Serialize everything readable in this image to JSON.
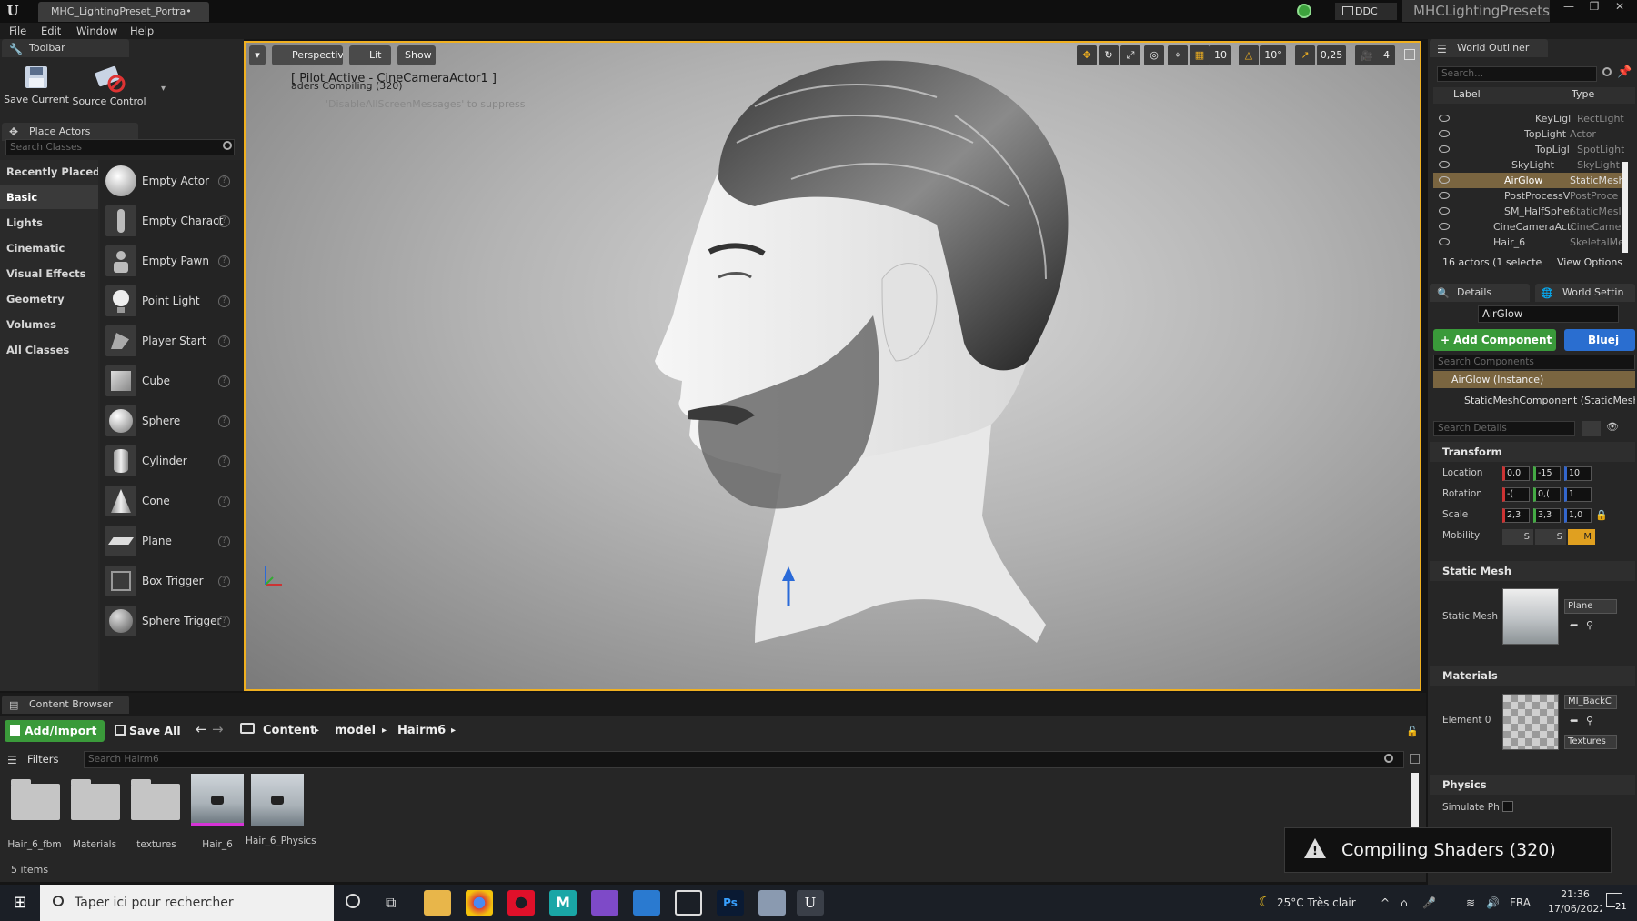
{
  "window": {
    "tab_title": "MHC_LightingPreset_Portra•",
    "ddc_label": "DDC",
    "project_name": "MHCLightingPresets"
  },
  "menu": [
    "File",
    "Edit",
    "Window",
    "Help"
  ],
  "toolbar": {
    "tab_label": "Toolbar",
    "save_current": "Save Current",
    "source_control": "Source Control"
  },
  "place_actors": {
    "tab_label": "Place Actors",
    "search_placeholder": "Search Classes",
    "categories": [
      "Recently Placed",
      "Basic",
      "Lights",
      "Cinematic",
      "Visual Effects",
      "Geometry",
      "Volumes",
      "All Classes"
    ],
    "active_category": "Basic",
    "items": [
      "Empty Actor",
      "Empty Charact",
      "Empty Pawn",
      "Point Light",
      "Player Start",
      "Cube",
      "Sphere",
      "Cylinder",
      "Cone",
      "Plane",
      "Box Trigger",
      "Sphere Trigger"
    ]
  },
  "viewport": {
    "perspective": "Perspective",
    "lit": "Lit",
    "show": "Show",
    "pilot_message": "[ Pilot Active - CineCameraActor1 ]",
    "compiling_message": "aders Compiling (320)",
    "suppress_message": "'DisableAllScreenMessages' to suppress",
    "grid_snap": "10",
    "rotation_snap": "10°",
    "scale_snap": "0,25",
    "camera_speed": "4"
  },
  "world_outliner": {
    "tab_label": "World Outliner",
    "search_placeholder": "Search...",
    "col_label": "Label",
    "col_type": "Type",
    "rows": [
      {
        "label": "KeyLigl",
        "type": "RectLight",
        "selected": false
      },
      {
        "label": "TopLight",
        "type": "Actor",
        "selected": false
      },
      {
        "label": "TopLigl",
        "type": "SpotLight",
        "selected": false
      },
      {
        "label": "SkyLight",
        "type": "SkyLight",
        "selected": false
      },
      {
        "label": "AirGlow",
        "type": "StaticMesh",
        "selected": true
      },
      {
        "label": "PostProcessV",
        "type": "PostProce",
        "selected": false
      },
      {
        "label": "SM_HalfSpher",
        "type": "StaticMesl",
        "selected": false
      },
      {
        "label": "CineCameraActc",
        "type": "CineCame",
        "selected": false
      },
      {
        "label": "Hair_6",
        "type": "SkeletalMe",
        "selected": false
      }
    ],
    "actor_count": "16 actors (1 selecte",
    "view_options": "View Options"
  },
  "details": {
    "tab_label": "Details",
    "world_settings_tab": "World Settin",
    "object_name": "AirGlow",
    "add_component": "+ Add Component",
    "blueprint": "Bluej",
    "search_components": "Search Components",
    "instance": "AirGlow (Instance)",
    "component": "StaticMeshComponent (StaticMeshC",
    "search_details": "Search Details",
    "transform_header": "Transform",
    "location_label": "Location",
    "rotation_label": "Rotation",
    "scale_label": "Scale",
    "mobility_label": "Mobility",
    "location": [
      "0,0",
      "-15",
      "10"
    ],
    "rotation": [
      "-(",
      "0,(",
      "1"
    ],
    "scale": [
      "2,3",
      "3,3",
      "1,0"
    ],
    "mobility_options": [
      "S",
      "S",
      "M"
    ],
    "static_mesh_header": "Static Mesh",
    "static_mesh_label": "Static Mesh",
    "static_mesh_value": "Plane",
    "materials_header": "Materials",
    "element0_label": "Element 0",
    "element0_value": "MI_BackC",
    "textures_value": "Textures",
    "physics_header": "Physics",
    "simulate_physics": "Simulate Ph"
  },
  "content_browser": {
    "tab_label": "Content Browser",
    "add_import": "Add/Import",
    "save_all": "Save All",
    "breadcrumb": [
      "Content",
      "model",
      "Hairm6"
    ],
    "filters": "Filters",
    "search_placeholder": "Search Hairm6",
    "assets": [
      "Hair_6_fbm",
      "Materials",
      "textures",
      "Hair_6",
      "Hair_6_Physics"
    ],
    "item_count": "5 items"
  },
  "toast": {
    "message": "Compiling Shaders (320)"
  },
  "taskbar": {
    "search_placeholder": "Taper ici pour rechercher",
    "weather": "25°C  Très clair",
    "language": "FRA",
    "time": "21:36",
    "date": "17/06/2022",
    "notification_count": "21"
  }
}
